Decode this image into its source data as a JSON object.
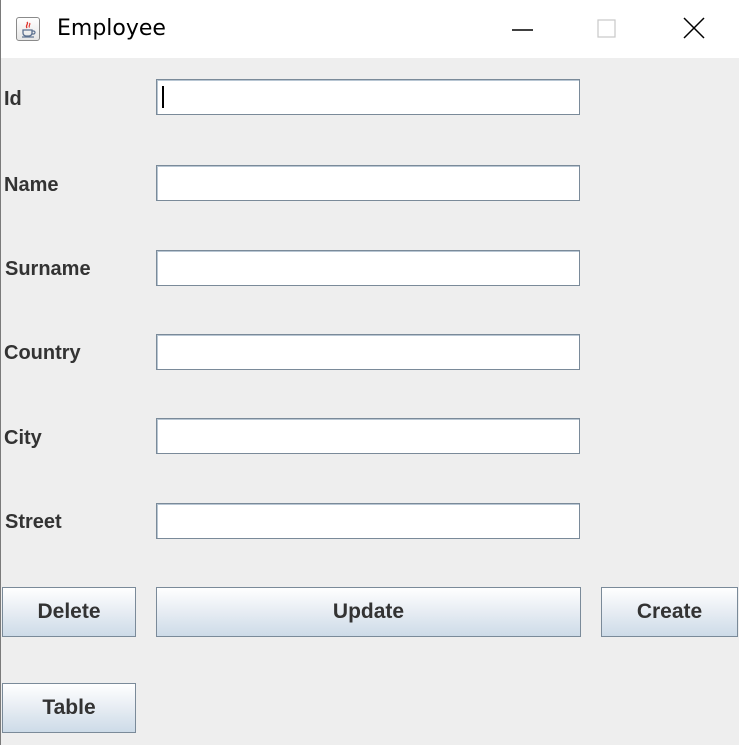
{
  "window": {
    "title": "Employee",
    "controls": [
      "minimize",
      "maximize",
      "close"
    ]
  },
  "form": {
    "fields": [
      {
        "label": "Id",
        "value": ""
      },
      {
        "label": "Name",
        "value": ""
      },
      {
        "label": "Surname",
        "value": ""
      },
      {
        "label": "Country",
        "value": ""
      },
      {
        "label": "City",
        "value": ""
      },
      {
        "label": "Street",
        "value": ""
      }
    ]
  },
  "buttons": {
    "delete": "Delete",
    "update": "Update",
    "create": "Create",
    "table": "Table"
  },
  "icons": {
    "app": "java-coffee-cup-icon",
    "minimize": "minimize-icon",
    "maximize": "maximize-icon",
    "close": "close-icon"
  }
}
